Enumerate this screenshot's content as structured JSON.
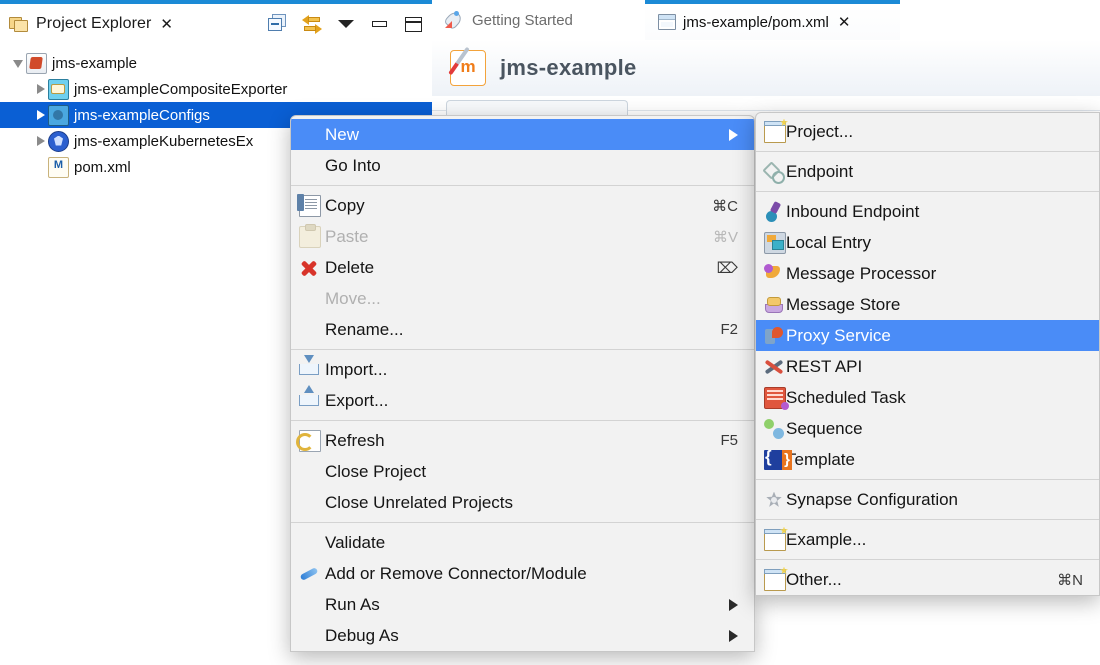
{
  "explorer": {
    "title": "Project Explorer",
    "close_glyph": "✕",
    "toolbar": [
      {
        "name": "collapse-all-icon",
        "label": "Collapse All"
      },
      {
        "name": "link-with-editor-icon",
        "label": "Link with Editor"
      },
      {
        "name": "view-menu-icon",
        "label": "View Menu"
      },
      {
        "name": "minimize-icon",
        "label": "Minimize"
      },
      {
        "name": "maximize-icon",
        "label": "Maximize"
      }
    ],
    "tree": [
      {
        "label": "jms-example",
        "depth": 0,
        "twisty": "open",
        "icon": "maven-project-icon",
        "selected": false
      },
      {
        "label": "jms-exampleCompositeExporter",
        "depth": 1,
        "twisty": "closed",
        "icon": "composite-exporter-icon",
        "selected": false
      },
      {
        "label": "jms-exampleConfigs",
        "depth": 1,
        "twisty": "closed",
        "icon": "esb-configs-icon",
        "selected": true
      },
      {
        "label": "jms-exampleKubernetesEx",
        "depth": 1,
        "twisty": "closed",
        "icon": "kubernetes-icon",
        "selected": false
      },
      {
        "label": "pom.xml",
        "depth": 2,
        "twisty": "none",
        "icon": "xml-file-icon",
        "selected": false
      }
    ]
  },
  "editor": {
    "tabs": [
      {
        "label": "Getting Started",
        "icon": "rocket-icon",
        "active": false,
        "closable": false
      },
      {
        "label": "jms-example/pom.xml",
        "icon": "xml-file-icon",
        "active": true,
        "closable": true,
        "close_glyph": "✕"
      }
    ],
    "doc_title": "jms-example",
    "doc_icon": "maven-pom-icon"
  },
  "context_menu": {
    "groups": [
      [
        {
          "label": "New",
          "icon": null,
          "submenu": true,
          "highlight": true,
          "disabled": false,
          "shortcut": ""
        },
        {
          "label": "Go Into",
          "icon": null,
          "submenu": false,
          "highlight": false,
          "disabled": false,
          "shortcut": ""
        }
      ],
      [
        {
          "label": "Copy",
          "icon": "copy-icon",
          "submenu": false,
          "highlight": false,
          "disabled": false,
          "shortcut": "⌘C"
        },
        {
          "label": "Paste",
          "icon": "paste-icon",
          "submenu": false,
          "highlight": false,
          "disabled": true,
          "shortcut": "⌘V"
        },
        {
          "label": "Delete",
          "icon": "delete-icon",
          "submenu": false,
          "highlight": false,
          "disabled": false,
          "shortcut": "⌦"
        },
        {
          "label": "Move...",
          "icon": null,
          "submenu": false,
          "highlight": false,
          "disabled": true,
          "shortcut": ""
        },
        {
          "label": "Rename...",
          "icon": null,
          "submenu": false,
          "highlight": false,
          "disabled": false,
          "shortcut": "F2"
        }
      ],
      [
        {
          "label": "Import...",
          "icon": "import-icon",
          "submenu": false,
          "highlight": false,
          "disabled": false,
          "shortcut": ""
        },
        {
          "label": "Export...",
          "icon": "export-icon",
          "submenu": false,
          "highlight": false,
          "disabled": false,
          "shortcut": ""
        }
      ],
      [
        {
          "label": "Refresh",
          "icon": "refresh-icon",
          "submenu": false,
          "highlight": false,
          "disabled": false,
          "shortcut": "F5"
        },
        {
          "label": "Close Project",
          "icon": null,
          "submenu": false,
          "highlight": false,
          "disabled": false,
          "shortcut": ""
        },
        {
          "label": "Close Unrelated Projects",
          "icon": null,
          "submenu": false,
          "highlight": false,
          "disabled": false,
          "shortcut": ""
        }
      ],
      [
        {
          "label": "Validate",
          "icon": null,
          "submenu": false,
          "highlight": false,
          "disabled": false,
          "shortcut": ""
        },
        {
          "label": "Add or Remove Connector/Module",
          "icon": "connector-icon",
          "submenu": false,
          "highlight": false,
          "disabled": false,
          "shortcut": ""
        },
        {
          "label": "Run As",
          "icon": null,
          "submenu": true,
          "highlight": false,
          "disabled": false,
          "shortcut": ""
        },
        {
          "label": "Debug As",
          "icon": null,
          "submenu": true,
          "highlight": false,
          "disabled": false,
          "shortcut": ""
        }
      ]
    ]
  },
  "submenu": {
    "groups": [
      [
        {
          "label": "Project...",
          "icon": "new-project-icon",
          "highlight": false,
          "shortcut": ""
        }
      ],
      [
        {
          "label": "Endpoint",
          "icon": "endpoint-icon",
          "highlight": false,
          "shortcut": ""
        }
      ],
      [
        {
          "label": "Inbound Endpoint",
          "icon": "inbound-endpoint-icon",
          "highlight": false,
          "shortcut": ""
        },
        {
          "label": "Local Entry",
          "icon": "local-entry-icon",
          "highlight": false,
          "shortcut": ""
        },
        {
          "label": "Message Processor",
          "icon": "message-processor-icon",
          "highlight": false,
          "shortcut": ""
        },
        {
          "label": "Message Store",
          "icon": "message-store-icon",
          "highlight": false,
          "shortcut": ""
        },
        {
          "label": "Proxy Service",
          "icon": "proxy-service-icon",
          "highlight": true,
          "shortcut": ""
        },
        {
          "label": "REST API",
          "icon": "rest-api-icon",
          "highlight": false,
          "shortcut": ""
        },
        {
          "label": "Scheduled Task",
          "icon": "scheduled-task-icon",
          "highlight": false,
          "shortcut": ""
        },
        {
          "label": "Sequence",
          "icon": "sequence-icon",
          "highlight": false,
          "shortcut": ""
        },
        {
          "label": "Template",
          "icon": "template-icon",
          "highlight": false,
          "shortcut": ""
        }
      ],
      [
        {
          "label": "Synapse Configuration",
          "icon": "synapse-config-icon",
          "highlight": false,
          "shortcut": ""
        }
      ],
      [
        {
          "label": "Example...",
          "icon": "new-example-icon",
          "highlight": false,
          "shortcut": ""
        }
      ],
      [
        {
          "label": "Other...",
          "icon": "new-other-icon",
          "highlight": false,
          "shortcut": "⌘N"
        }
      ]
    ]
  },
  "colors": {
    "tree_selection": "#0a5fd4",
    "menu_highlight": "#4a8cf7",
    "tab_accent": "#1b8ad6",
    "menu_bg": "#f2f2f2"
  }
}
